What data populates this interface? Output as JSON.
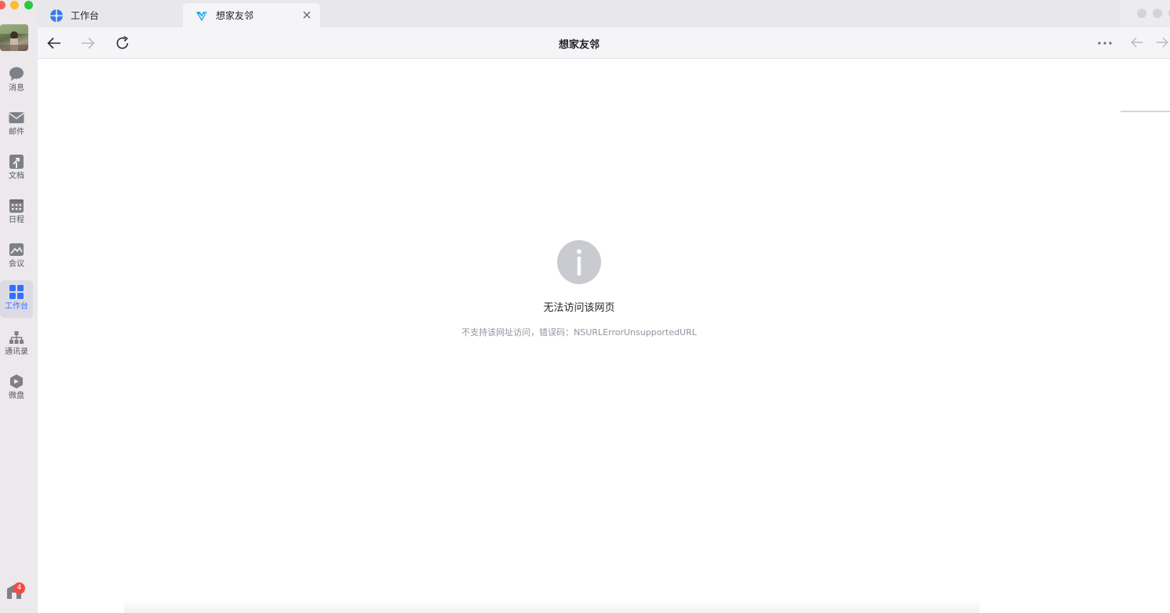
{
  "window": {
    "title": "想家友邻"
  },
  "sidebar": {
    "notification_count": "4",
    "items": [
      {
        "label": "消息",
        "icon": "chat-bubble-icon"
      },
      {
        "label": "邮件",
        "icon": "mail-icon"
      },
      {
        "label": "文档",
        "icon": "document-icon"
      },
      {
        "label": "日程",
        "icon": "calendar-icon"
      },
      {
        "label": "会议",
        "icon": "meeting-icon"
      },
      {
        "label": "工作台",
        "icon": "workbench-grid-icon",
        "active": true
      },
      {
        "label": "通讯录",
        "icon": "contacts-tree-icon"
      },
      {
        "label": "微盘",
        "icon": "drive-icon"
      }
    ]
  },
  "tabs": [
    {
      "label": "工作台",
      "icon": "workbench-logo-icon",
      "active": false
    },
    {
      "label": "想家友邻",
      "icon": "miniapp-logo-icon",
      "active": true
    }
  ],
  "toolbar": {
    "title": "想家友邻",
    "back_icon": "arrow-left-icon",
    "forward_icon": "arrow-right-icon",
    "reload_icon": "reload-icon",
    "more_icon": "more-dots-icon"
  },
  "error": {
    "title": "无法访问该网页",
    "description": "不支持该网址访问，错误码：NSURLErrorUnsupportedURL"
  },
  "colors": {
    "accent": "#3370ff",
    "sidebar_bg": "#ece8ec",
    "badge": "#f54a45",
    "info_icon": "#c9cbd1"
  }
}
